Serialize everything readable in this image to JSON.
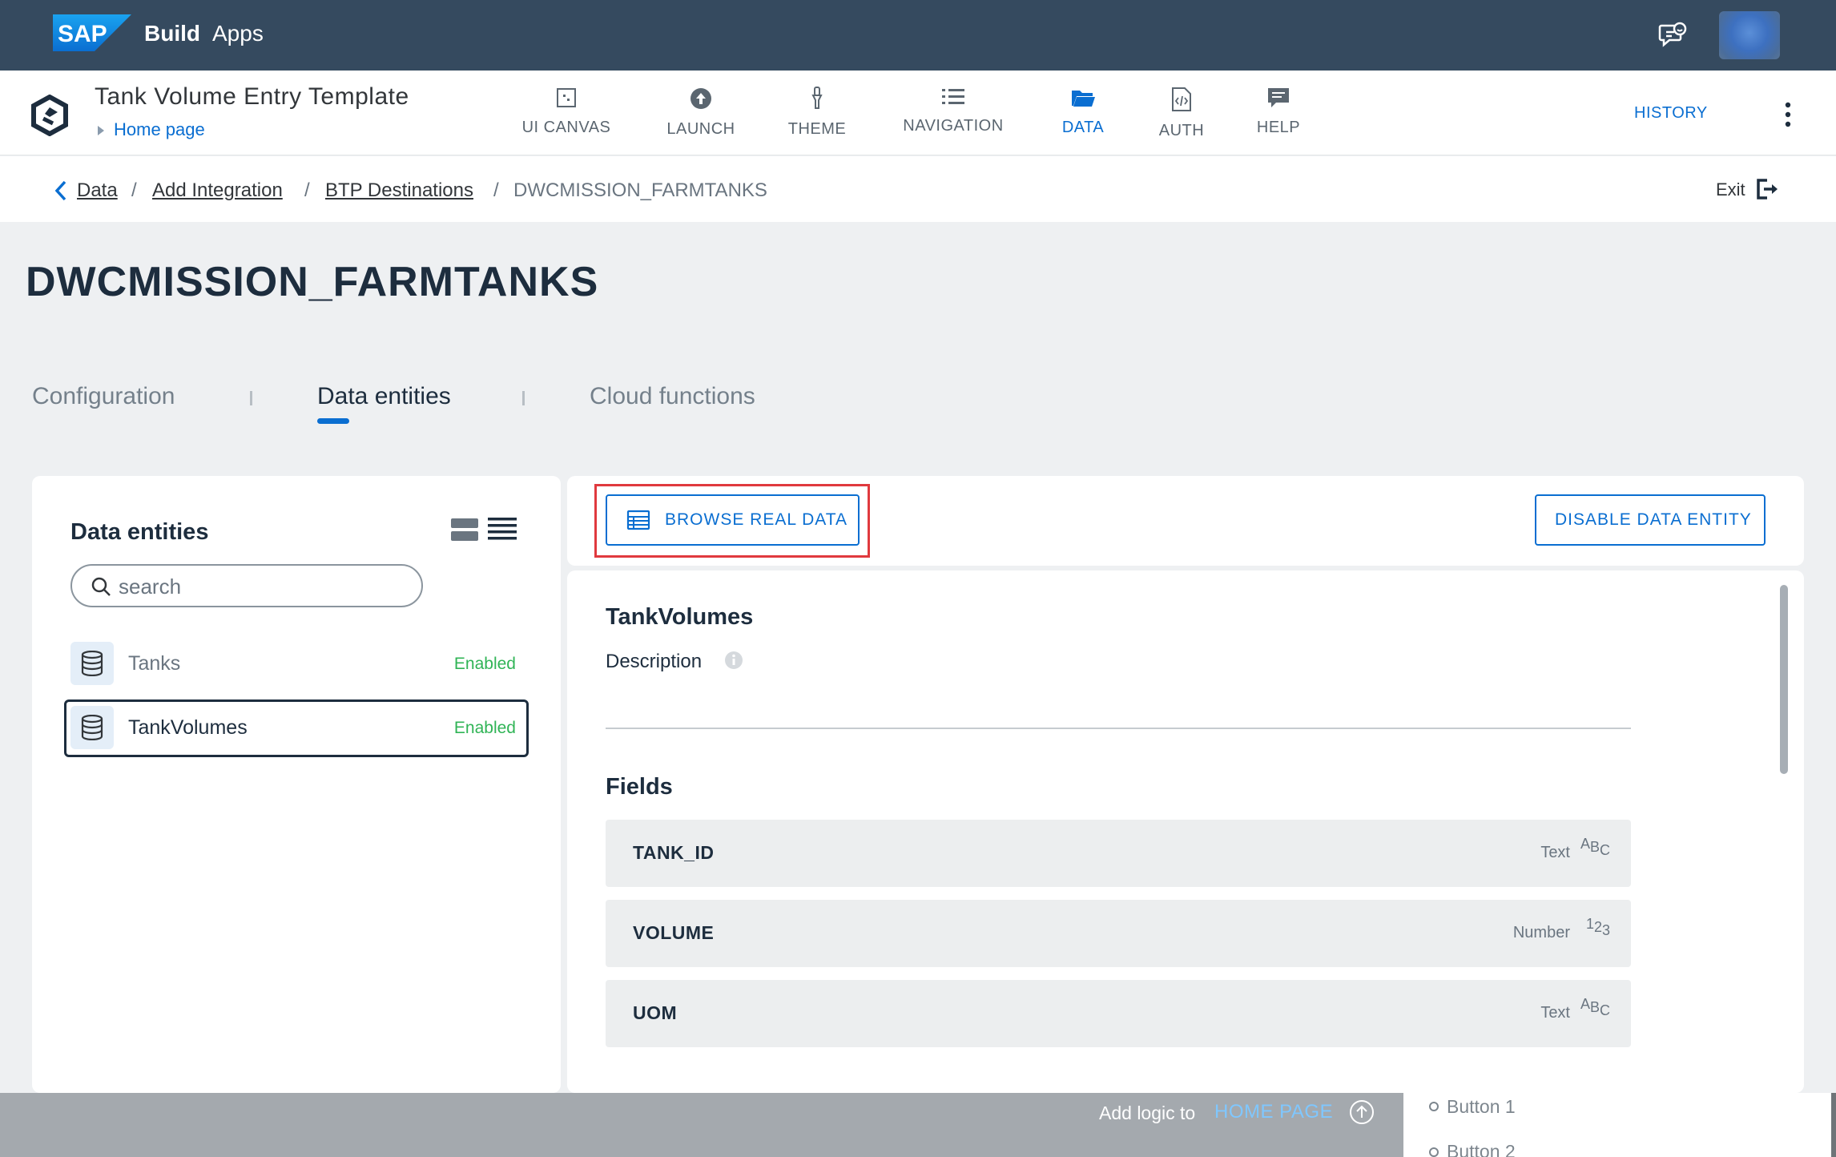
{
  "shell": {
    "logo_text": "SAP",
    "product_bold": "Build",
    "product": "Apps",
    "icons": [
      "sap-logo",
      "feedback-icon",
      "user-avatar"
    ]
  },
  "app_header": {
    "project_title": "Tank Volume Entry Template",
    "page_link": "Home page",
    "nav_tabs": [
      {
        "label": "UI CANVAS",
        "icon": "ui-canvas-icon"
      },
      {
        "label": "LAUNCH",
        "icon": "launch-icon"
      },
      {
        "label": "THEME",
        "icon": "theme-icon"
      },
      {
        "label": "NAVIGATION",
        "icon": "navigation-icon"
      },
      {
        "label": "DATA",
        "icon": "data-folder-icon",
        "active": true
      },
      {
        "label": "AUTH",
        "icon": "auth-icon"
      },
      {
        "label": "HELP",
        "icon": "help-icon"
      }
    ],
    "history_label": "HISTORY"
  },
  "breadcrumb": {
    "items": [
      "Data",
      "Add Integration",
      "BTP Destinations",
      "DWCMISSION_FARMTANKS"
    ],
    "separator": "/",
    "exit_label": "Exit"
  },
  "page": {
    "title": "DWCMISSION_FARMTANKS",
    "tabs": [
      {
        "label": "Configuration"
      },
      {
        "label": "Data entities",
        "active": true
      },
      {
        "label": "Cloud functions"
      }
    ]
  },
  "entities_panel": {
    "title": "Data entities",
    "search_placeholder": "search",
    "items": [
      {
        "name": "Tanks",
        "status": "Enabled",
        "selected": false
      },
      {
        "name": "TankVolumes",
        "status": "Enabled",
        "selected": true
      }
    ]
  },
  "toolbar": {
    "browse_label": "BROWSE REAL DATA",
    "disable_label": "DISABLE DATA ENTITY"
  },
  "details": {
    "entity_name": "TankVolumes",
    "description_label": "Description",
    "fields_label": "Fields",
    "fields": [
      {
        "name": "TANK_ID",
        "type": "Text",
        "glyph": [
          "A",
          "B",
          "C"
        ]
      },
      {
        "name": "VOLUME",
        "type": "Number",
        "glyph": [
          "1",
          "2",
          "3"
        ]
      },
      {
        "name": "UOM",
        "type": "Text",
        "glyph": [
          "A",
          "B",
          "C"
        ]
      }
    ]
  },
  "bottom_bar": {
    "add_logic_label": "Add logic to",
    "home_page_link": "HOME PAGE",
    "tree_items": [
      "Button 1",
      "Button 2"
    ]
  },
  "colors": {
    "shell_bg": "#354a5f",
    "accent": "#0a6ed1",
    "enabled_green": "#30b456",
    "highlight_red": "#e0393e"
  }
}
